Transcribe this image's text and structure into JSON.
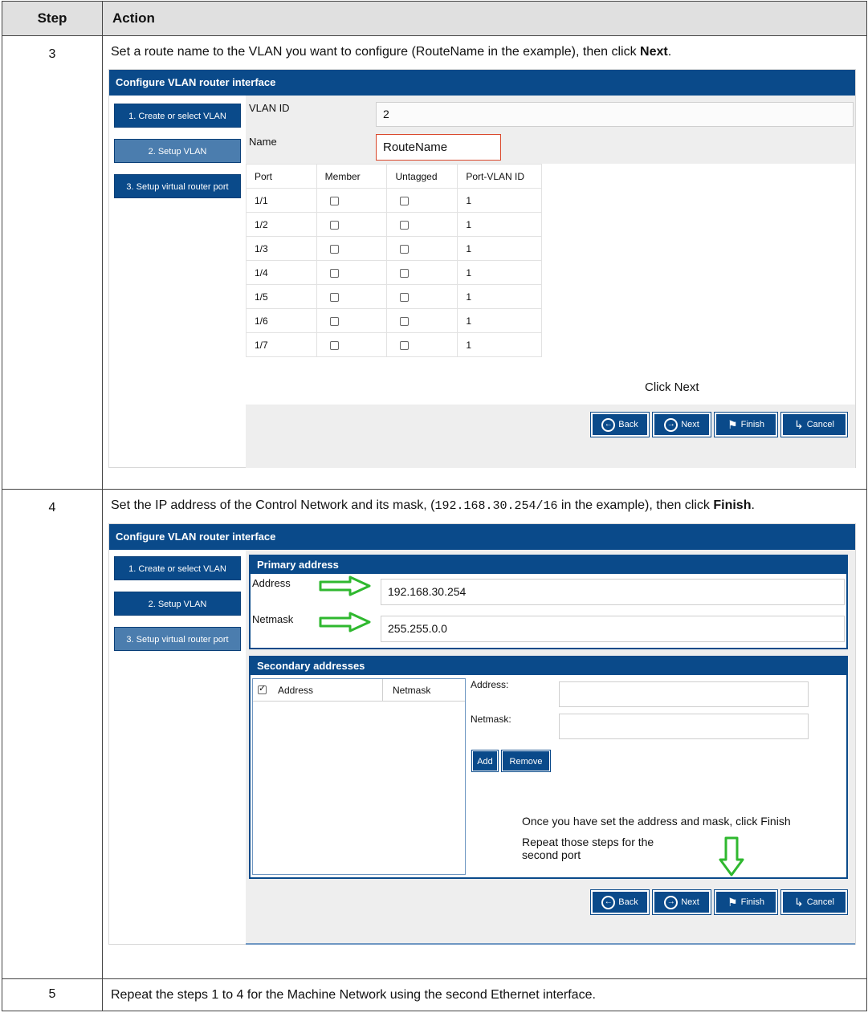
{
  "table": {
    "header_step": "Step",
    "header_action": "Action"
  },
  "steps": [
    {
      "number": "3",
      "text_a": "Set a route name to the VLAN you want to configure (RouteName in the example), then click ",
      "text_bold": "Next",
      "text_b": "."
    },
    {
      "number": "4",
      "text_a": "Set the IP address of the Control Network and its mask, (",
      "text_mono": "192.168.30.254/16",
      "text_b": " in the example), then click ",
      "text_bold": "Finish",
      "text_c": "."
    },
    {
      "number": "5",
      "text_a": "Repeat the steps 1 to 4 for the Machine Network using the second Ethernet interface."
    }
  ],
  "panel1": {
    "title": "Configure VLAN router interface",
    "nav": [
      "1. Create or select VLAN",
      "2. Setup VLAN",
      "3. Setup virtual router port"
    ],
    "vlan_id_label": "VLAN ID",
    "vlan_id_value": "2",
    "name_label": "Name",
    "name_value": "RouteName",
    "columns": [
      "Port",
      "Member",
      "Untagged",
      "Port-VLAN ID"
    ],
    "rows": [
      {
        "port": "1/1",
        "pvid": "1"
      },
      {
        "port": "1/2",
        "pvid": "1"
      },
      {
        "port": "1/3",
        "pvid": "1"
      },
      {
        "port": "1/4",
        "pvid": "1"
      },
      {
        "port": "1/5",
        "pvid": "1"
      },
      {
        "port": "1/6",
        "pvid": "1"
      },
      {
        "port": "1/7",
        "pvid": "1"
      }
    ],
    "annotation": "Click Next",
    "buttons": {
      "back": "Back",
      "next": "Next",
      "finish": "Finish",
      "cancel": "Cancel"
    }
  },
  "panel2": {
    "title": "Configure VLAN router interface",
    "nav": [
      "1. Create or select VLAN",
      "2. Setup VLAN",
      "3. Setup virtual router port"
    ],
    "primary_title": "Primary address",
    "address_label": "Address",
    "address_value": "192.168.30.254",
    "netmask_label": "Netmask",
    "netmask_value": "255.255.0.0",
    "secondary_title": "Secondary addresses",
    "sec_col_address": "Address",
    "sec_col_netmask": "Netmask",
    "sec_address_label": "Address:",
    "sec_netmask_label": "Netmask:",
    "add_label": "Add",
    "remove_label": "Remove",
    "annotation1": "Once you have set the address and mask, click Finish",
    "annotation2_line1": "Repeat those steps for the",
    "annotation2_line2": "second port",
    "buttons": {
      "back": "Back",
      "next": "Next",
      "finish": "Finish",
      "cancel": "Cancel"
    }
  },
  "colors": {
    "accent": "#0a4a8a",
    "nav_active": "#4b7dae",
    "arrow": "#2fb82f",
    "name_border": "#d9472b"
  }
}
